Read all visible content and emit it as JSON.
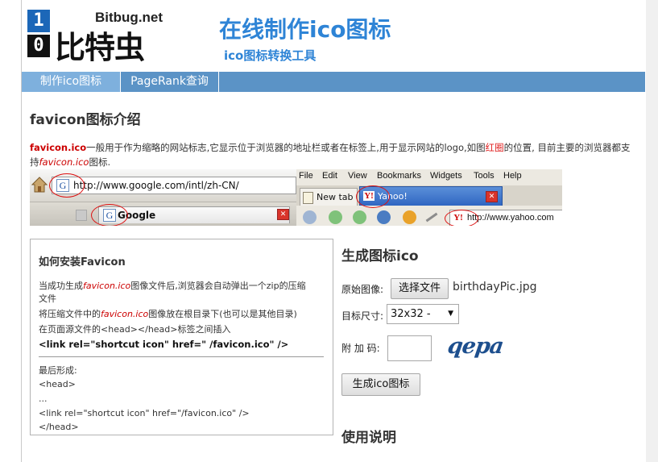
{
  "header": {
    "logo_digit_top": "1",
    "logo_digit_bottom": "0",
    "logo_site": "Bitbug.net",
    "logo_name": "比特虫",
    "title": "在线制作ico图标",
    "subtitle": "ico图标转换工具"
  },
  "nav": {
    "items": [
      {
        "label": "制作ico图标",
        "active": true
      },
      {
        "label": "PageRank查询",
        "active": false
      }
    ]
  },
  "intro": {
    "heading": "favicon图标介绍",
    "term": "favicon.ico",
    "text_a": "一般用于作为缩略的网站标志,它显示位于浏览器的地址栏或者在标签上,用于显示网站的logo,如图",
    "red_word": "红圈",
    "text_b": "的位置, 目前主要的浏览器都支持",
    "term_ital": "favicon.ico",
    "text_c": "图标."
  },
  "demo": {
    "ie_url": "http://www.google.com/intl/zh-CN/",
    "ie_tab": "Google",
    "g_letter": "G",
    "ff_menu": [
      "File",
      "Edit",
      "View",
      "Bookmarks",
      "Widgets",
      "Tools",
      "Help"
    ],
    "ff_tab1": "New tab",
    "ff_tab2": "Yahoo!",
    "ff_url": "http://www.yahoo.com",
    "y_letter": "Y!"
  },
  "install": {
    "title": "如何安装Favicon",
    "line1a": "当成功生成",
    "line1_term": "favicon.ico",
    "line1b": "图像文件后,浏览器会自动弹出一个zip的压缩",
    "line2": "文件",
    "line3a": "将压缩文件中的",
    "line3_term": "favicon.ico",
    "line3b": "图像放在根目录下(也可以是其他目录)",
    "line4": "在页面源文件的<head></head>标签之间插入",
    "line5": "<link rel=\"shortcut icon\" href=\" /favicon.ico\" />",
    "line6": "最后形成:",
    "line7": "<head>",
    "line8": "...",
    "line9": "<link rel=\"shortcut icon\" href=\"/favicon.ico\" />",
    "line10": "</head>"
  },
  "form": {
    "title": "生成图标ico",
    "source_label": "原始图像:",
    "file_button": "选择文件",
    "file_name": "birthdayPic.jpg",
    "size_label": "目标尺寸:",
    "size_value": "32x32 -",
    "code_label": "附 加 码:",
    "captcha": "qepa",
    "submit": "生成ico图标"
  },
  "usage": {
    "title": "使用说明"
  }
}
